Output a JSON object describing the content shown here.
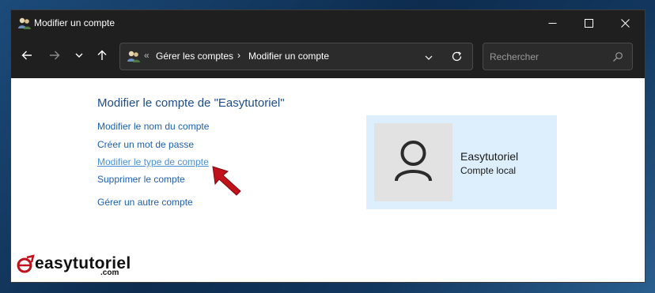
{
  "window": {
    "title": "Modifier un compte",
    "controls": {
      "minimize": "minimize-icon",
      "maximize": "maximize-icon",
      "close": "close-icon"
    }
  },
  "navigation": {
    "back_icon": "arrow-left-icon",
    "forward_icon": "arrow-right-icon",
    "recent_icon": "chevron-down-icon",
    "up_icon": "arrow-up-icon"
  },
  "address_bar": {
    "icon": "users-icon",
    "overflow": "«",
    "breadcrumbs": [
      "Gérer les comptes",
      "Modifier un compte"
    ],
    "separator": "›",
    "dropdown_icon": "chevron-down-icon",
    "refresh_icon": "refresh-icon"
  },
  "search": {
    "placeholder": "Rechercher",
    "icon": "search-icon"
  },
  "content": {
    "heading": "Modifier le compte de \"Easytutoriel\"",
    "links": [
      "Modifier le nom du compte",
      "Créer un mot de passe",
      "Modifier le type de compte",
      "Supprimer le compte",
      "Gérer un autre compte"
    ],
    "hover_link_index": 2,
    "annotation": "red-arrow-pointer"
  },
  "account": {
    "name": "Easytutoriel",
    "type": "Compte local",
    "avatar_icon": "user-avatar-icon"
  },
  "watermark": {
    "text": "easytutoriel",
    "domain": ".com"
  },
  "colors": {
    "title_bar": "#1f1f1f",
    "link": "#1e5fae",
    "link_hover": "#4a90d8",
    "heading": "#1e4c8b",
    "card": "#ddeefc",
    "arrow": "#c0121b"
  }
}
